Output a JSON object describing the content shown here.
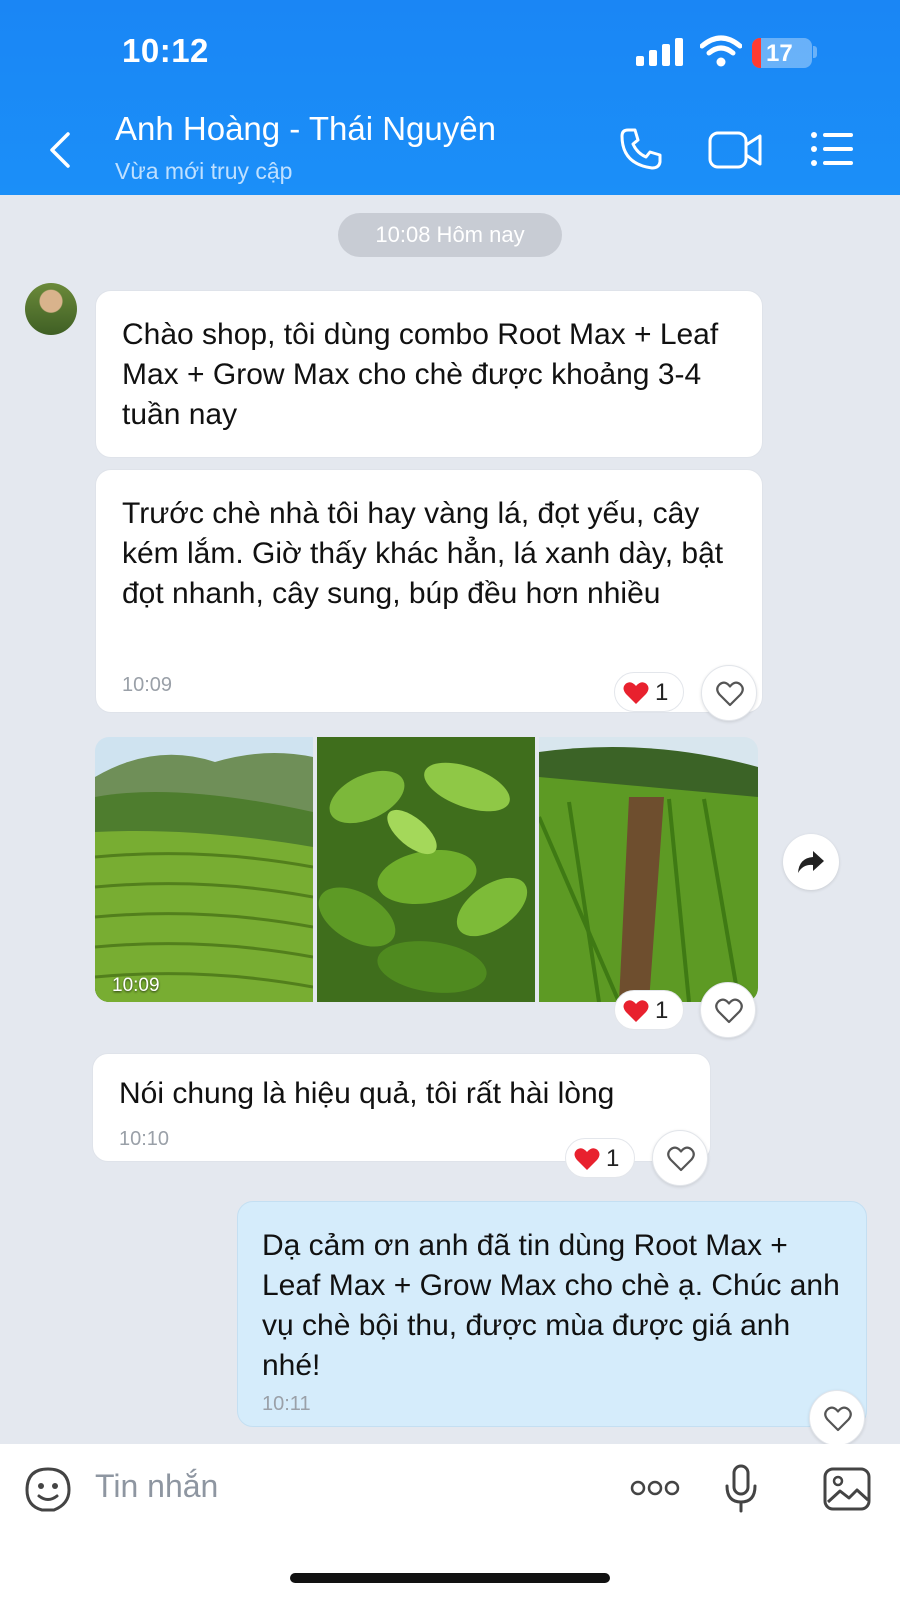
{
  "status_bar": {
    "time": "10:12",
    "battery": "17"
  },
  "header": {
    "contact_name": "Anh Hoàng - Thái Nguyên",
    "contact_status": "Vừa mới truy cập"
  },
  "day_separator": "10:08 Hôm nay",
  "messages": [
    {
      "text": "Chào shop, tôi dùng combo Root Max + Leaf Max + Grow Max cho chè được khoảng 3-4 tuần nay"
    },
    {
      "text": "Trước chè nhà tôi hay vàng lá, đọt yếu, cây kém lắm. Giờ thấy khác hẳn, lá xanh dày, bật đọt nhanh, cây sung, búp đều hơn nhiều",
      "time": "10:09",
      "reaction_count": "1"
    },
    {
      "type": "photos",
      "time": "10:09",
      "reaction_count": "1"
    },
    {
      "text": "Nói chung là hiệu quả, tôi rất hài lòng",
      "time": "10:10",
      "reaction_count": "1"
    },
    {
      "text": "Dạ cảm ơn anh đã tin dùng Root Max + Leaf Max + Grow Max cho chè ạ. Chúc anh vụ chè bội thu, được mùa được giá anh nhé!",
      "time": "10:11"
    }
  ],
  "input": {
    "placeholder": "Tin nhắn"
  },
  "colors": {
    "header_blue": "#1a86f5",
    "my_bubble": "#d5ecfb",
    "heart": "#e8212e"
  }
}
